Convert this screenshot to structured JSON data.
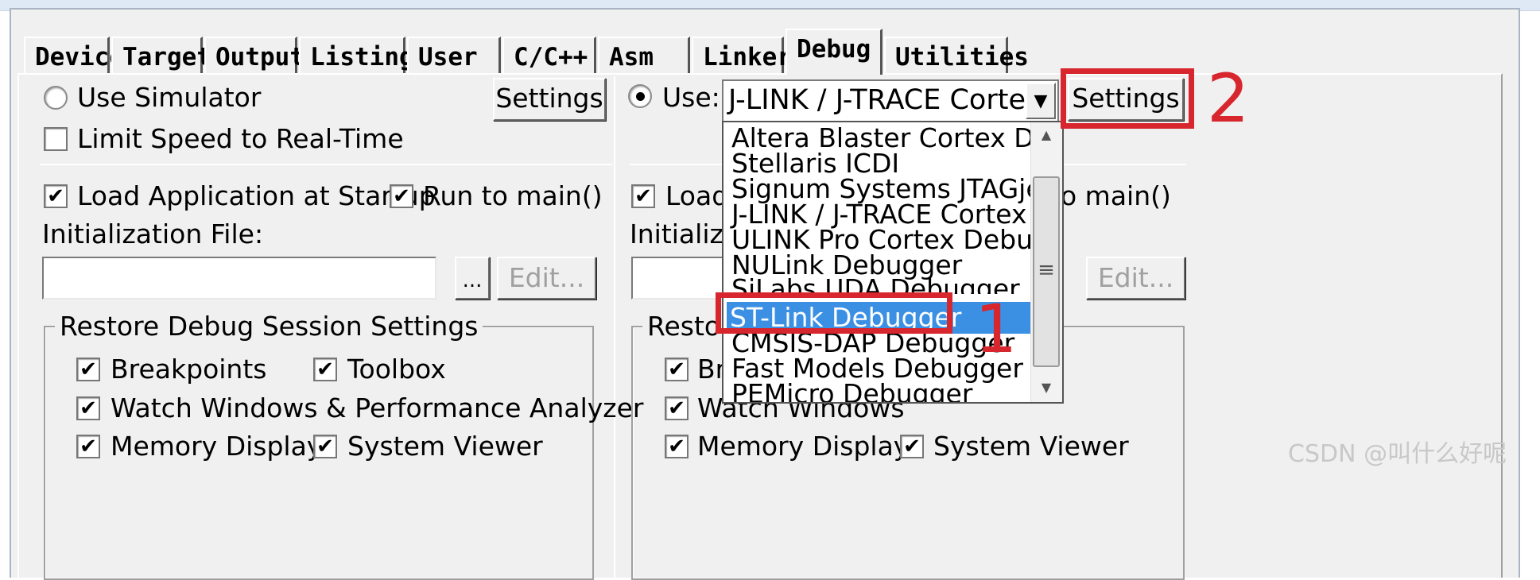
{
  "tabs": [
    "Device",
    "Target",
    "Output",
    "Listing",
    "User",
    "C/C++",
    "Asm",
    "Linker",
    "Debug",
    "Utilities"
  ],
  "active_tab": "Debug",
  "left": {
    "use_simulator_label": "Use Simulator",
    "use_simulator_selected": false,
    "settings_label": "Settings",
    "limit_speed_label": "Limit Speed to Real-Time",
    "limit_speed_checked": false,
    "load_app_label": "Load Application at Startup",
    "run_to_main_label": "Run to main()",
    "init_file_label": "Initialization File:",
    "init_file_value": "",
    "browse_label": "...",
    "edit_label": "Edit...",
    "restore_group_label": "Restore Debug Session Settings",
    "breakpoints_label": "Breakpoints",
    "toolbox_label": "Toolbox",
    "watch_label": "Watch Windows & Performance Analyzer",
    "memory_label": "Memory Display",
    "sysviewer_label": "System Viewer",
    "check_mark": "✔"
  },
  "right": {
    "use_label": "Use:",
    "use_selected": true,
    "debugger_value": "J-LINK / J-TRACE Cortex",
    "combo_arrow": "▼",
    "settings_label": "Settings",
    "load_partial": "Load A",
    "run_partial": "o main()",
    "init_partial": "Initializatio",
    "edit_label": "Edit...",
    "restore_partial": "Restore",
    "bre_partial": "Bre",
    "watch_label": "Watch Windows",
    "memory_label": "Memory Display",
    "sysviewer_label": "System Viewer",
    "check_mark": "✔"
  },
  "dropdown": {
    "items": [
      "Altera Blaster Cortex Debugger",
      "Stellaris ICDI",
      "Signum Systems JTAGjet",
      "J-LINK / J-TRACE Cortex",
      "ULINK Pro Cortex Debugger",
      "NULink Debugger",
      "SiLabs UDA Debugger",
      "ST-Link Debugger",
      "CMSIS-DAP Debugger",
      "Fast Models Debugger",
      "PEMicro Debugger"
    ],
    "selected": "ST-Link Debugger",
    "scroll_up": "▲",
    "scroll_down": "▼",
    "grip": "≡"
  },
  "annotations": {
    "marker_1": "1",
    "marker_2": "2",
    "color": "#d7262d"
  },
  "watermark": "CSDN @叫什么好呢"
}
